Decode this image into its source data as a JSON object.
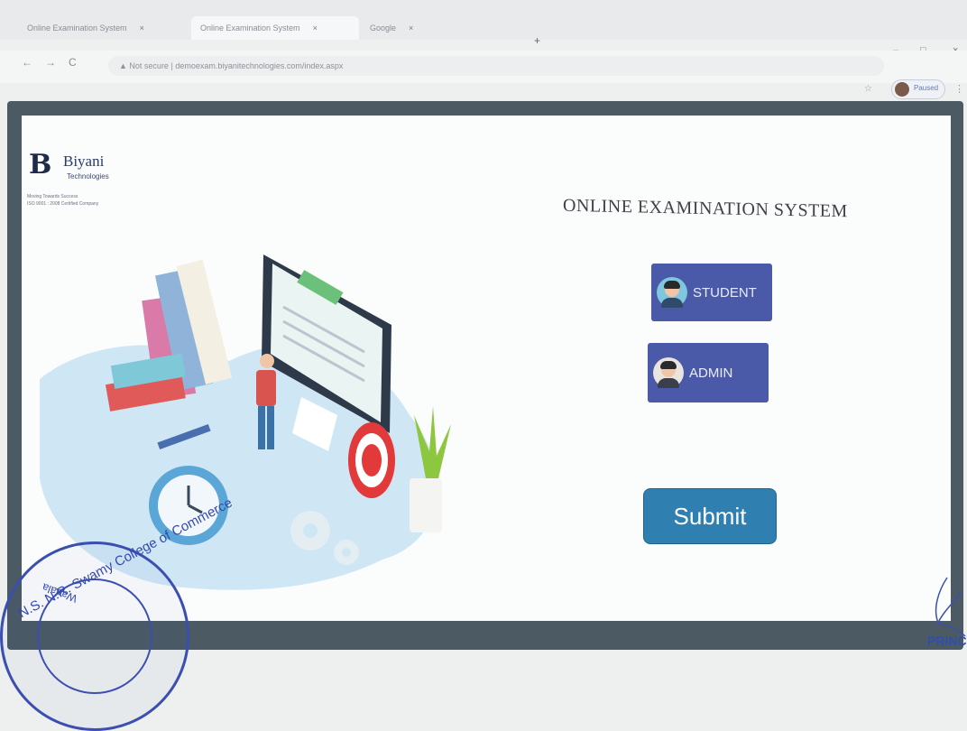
{
  "browser": {
    "tabs": [
      {
        "label": "Online Examination System",
        "close": "×"
      },
      {
        "label": "Online Examination System",
        "close": "×"
      },
      {
        "label": "Google",
        "close": "×"
      }
    ],
    "new_tab": "+",
    "back": "←",
    "forward": "→",
    "reload": "C",
    "security": "Not secure",
    "url": "demoexam.biyanitechnologies.com/index.aspx",
    "star": "☆",
    "profile_label": "Paused",
    "menu": "⋮",
    "minimize": "–",
    "maximize": "□",
    "close": "×"
  },
  "logo": {
    "mark": "B",
    "brand": "Biyani",
    "sub": "Technologies",
    "line1": "Moving Towards Success",
    "line2": "ISO 9001 : 2008 Certified Company"
  },
  "page": {
    "title": "ONLINE EXAMINATION SYSTEM",
    "student_label": "STUDENT",
    "admin_label": "ADMIN",
    "submit_label": "Submit"
  },
  "stamp": {
    "ring_text": "N.S. N.R. Swamy College of Commerce",
    "inner_text": "Wadala",
    "signature_caption": "PRINCIPAL"
  },
  "colors": {
    "frame": "#4b5a63",
    "role_button": "#4b5aa8",
    "submit_button": "#2f7fb0",
    "stamp_ink": "#3b4fb0"
  }
}
